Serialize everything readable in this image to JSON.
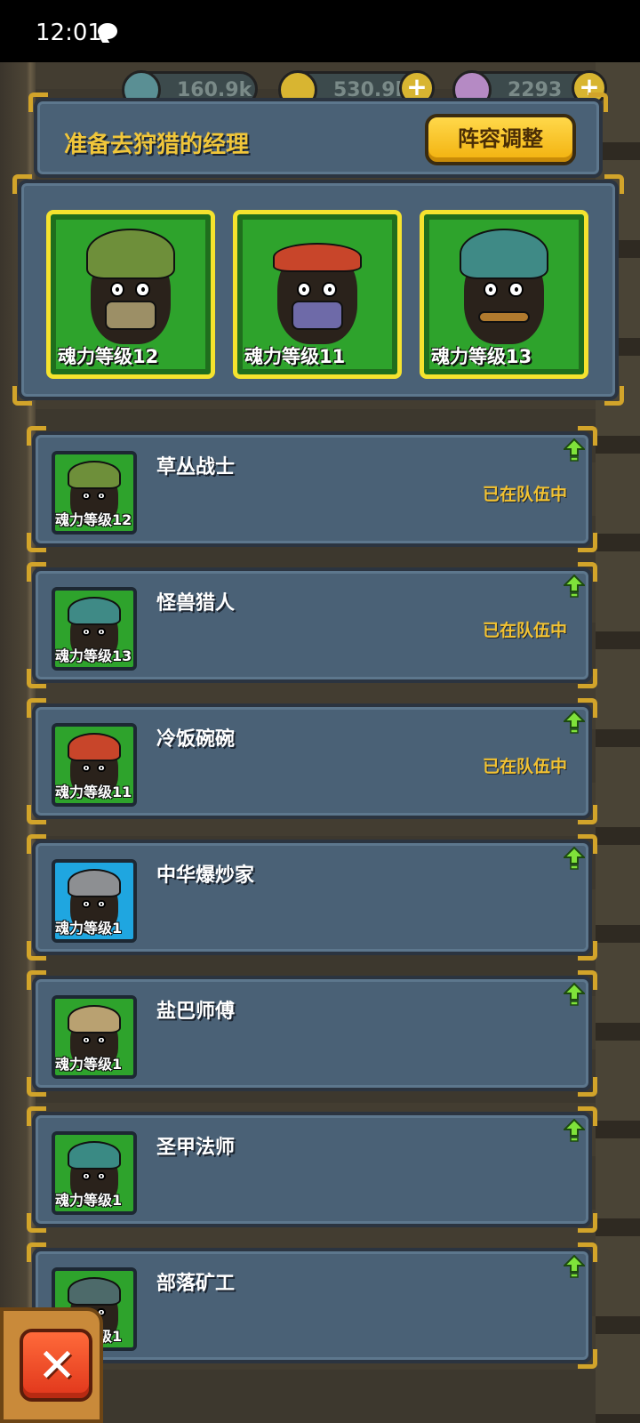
{
  "status_bar": {
    "time": "12:01",
    "icons": [
      "message-icon"
    ]
  },
  "resources": [
    {
      "name": "energy",
      "value": "160.9k",
      "icon": "eye-orb-icon",
      "color": "#5a8f94"
    },
    {
      "name": "coins",
      "value": "530.9k",
      "icon": "coin-icon",
      "color": "#d8b531"
    },
    {
      "name": "potion",
      "value": "2293",
      "icon": "potion-icon",
      "color": "#b58ac4"
    }
  ],
  "panel": {
    "title": "准备去狩猎的经理",
    "adjust_button": "阵容调整"
  },
  "team": [
    {
      "level_label": "魂力等级12",
      "color": "#6e8f3a"
    },
    {
      "level_label": "魂力等级11",
      "color": "#c8452a"
    },
    {
      "level_label": "魂力等级13",
      "color": "#3f8a86"
    }
  ],
  "managers": [
    {
      "name": "草丛战士",
      "level_label": "魂力等级12",
      "status": "已在队伍中",
      "bg": "green",
      "color": "#6e8f3a"
    },
    {
      "name": "怪兽猎人",
      "level_label": "魂力等级13",
      "status": "已在队伍中",
      "bg": "green",
      "color": "#3f8a86"
    },
    {
      "name": "冷饭碗碗",
      "level_label": "魂力等级11",
      "status": "已在队伍中",
      "bg": "green",
      "color": "#c8452a"
    },
    {
      "name": "中华爆炒家",
      "level_label": "魂力等级1",
      "status": "",
      "bg": "blue",
      "color": "#8d8f92"
    },
    {
      "name": "盐巴师傅",
      "level_label": "魂力等级1",
      "status": "",
      "bg": "green",
      "color": "#b9a171"
    },
    {
      "name": "圣甲法师",
      "level_label": "魂力等级1",
      "status": "",
      "bg": "green",
      "color": "#3a8a84"
    },
    {
      "name": "部落矿工",
      "level_label": "魂力等级1",
      "status": "",
      "bg": "green",
      "color": "#4d6a6a"
    }
  ],
  "close_button": {
    "icon": "close-x-icon",
    "symbol": "✕"
  }
}
